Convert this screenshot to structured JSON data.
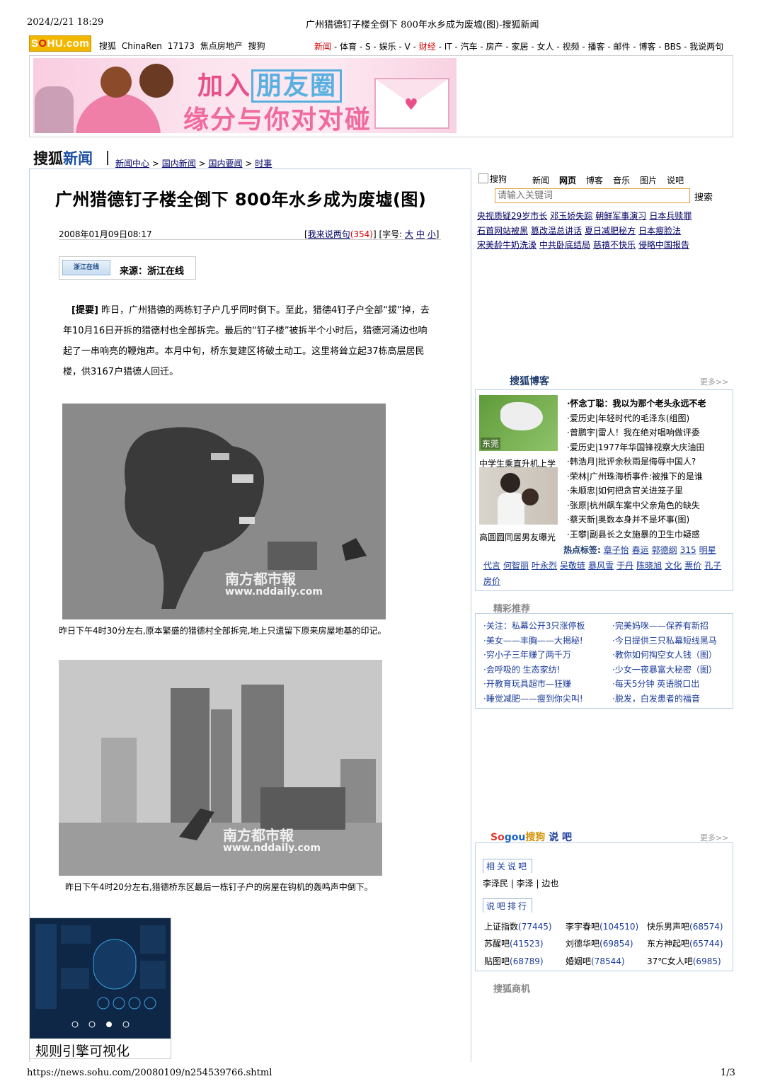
{
  "print": {
    "date": "2024/2/21 18:29",
    "title": "广州猎德钉子楼全倒下 800年水乡成为废墟(图)-搜狐新闻",
    "url": "https://news.sohu.com/20080109/n254539766.shtml",
    "page": "1/3"
  },
  "topbar": {
    "logo_a": "S",
    "logo_b": "O",
    "logo_c": "HU.com",
    "network_links": [
      "搜狐",
      "ChinaRen",
      "17173",
      "焦点房地产",
      "搜狗"
    ],
    "channels": [
      {
        "label": "新闻",
        "highlight": true
      },
      {
        "label": "体育",
        "highlight": false
      },
      {
        "label": "S",
        "highlight": false
      },
      {
        "label": "娱乐",
        "highlight": false
      },
      {
        "label": "V",
        "highlight": false
      },
      {
        "label": "财经",
        "highlight": true
      },
      {
        "label": "IT",
        "highlight": false
      },
      {
        "label": "汽车",
        "highlight": false
      },
      {
        "label": "房产",
        "highlight": false
      },
      {
        "label": "家居",
        "highlight": false
      },
      {
        "label": "女人",
        "highlight": false
      },
      {
        "label": "视频",
        "highlight": false
      },
      {
        "label": "播客",
        "highlight": false
      },
      {
        "label": "邮件",
        "highlight": false
      },
      {
        "label": "博客",
        "highlight": false
      },
      {
        "label": "BBS",
        "highlight": false
      },
      {
        "label": "我说两句",
        "highlight": false
      }
    ]
  },
  "banner": {
    "line1_a": "加入",
    "line1_b": "朋友圈",
    "line2": "缘分与你对对碰",
    "love": "love"
  },
  "section": {
    "logo_a": "搜狐",
    "logo_b": "新闻",
    "breadcrumb": [
      "新闻中心",
      "国内新闻",
      "国内要闻",
      "时事"
    ],
    "sep": ">"
  },
  "article": {
    "title": "广州猎德钉子楼全倒下 800年水乡成为废墟(图)",
    "date": "2008年01月09日08:17",
    "comment_label": "我来说两句",
    "comment_count": "(354)",
    "font_label": "[字号:",
    "font_sizes": [
      "大",
      "中",
      "小"
    ],
    "source_logo": "浙江在线",
    "source": "来源：浙江在线",
    "summary_lead": "[提要]",
    "summary": "昨日，广州猎德的两栋钉子户几乎同时倒下。至此，猎德4钉子户全部“拔”掉，去年10月16日开拆的猎德村也全部拆完。最后的“钉子楼”被拆半个小时后，猎德河涌边也响起了一串响亮的鞭炮声。本月中旬，桥东复建区将破土动工。这里将耸立起37栋高层居民楼，供3167户猎德人回迁。",
    "watermark_a": "南方都市報",
    "watermark_b": "www.nddaily.com",
    "caption1": "昨日下午4时30分左右,原本繁盛的猎德村全部拆完,地上只遗留下原来房屋地基的印记。",
    "caption2": "昨日下午4时20分左右,猎德桥东区最后一栋钉子户的房屋在钩机的轰鸣声中倒下。"
  },
  "ad": {
    "label": "规则引擎可视化"
  },
  "search": {
    "img_alt": "搜狗",
    "tabs": [
      "新闻",
      "网页",
      "博客",
      "音乐",
      "图片",
      "说吧"
    ],
    "active_tab": "网页",
    "placeholder": "请输入关键词",
    "button": "搜索",
    "hot_lines": [
      [
        "央视质疑29岁市长",
        "邓玉娇失踪",
        "朝鲜军事演习",
        "日本兵赎罪"
      ],
      [
        "石首网站被黑",
        "篡改温总讲话",
        "夏日减肥秘方",
        "日本瘦脸法"
      ],
      [
        "宋美龄牛奶洗澡",
        "中共卧底结局",
        "慈禧不快乐",
        "侵略中国报告"
      ]
    ]
  },
  "blog": {
    "title": "搜狐博客",
    "more": "更多>>",
    "thumb1_tag": "东莞",
    "thumb1_caption": "中学生乘直升机上学",
    "thumb2_caption": "高圆圆同居男友曝光",
    "items": [
      "·怀念丁聪：我以为那个老头永远不老",
      "·爱历史|年轻时代的毛泽东(组图)",
      "·曾鹏宇|雷人！我在绝对唱响做评委",
      "·爱历史|1977年华国锋视察大庆油田",
      "·韩浩月|批评余秋雨是侮辱中国人?",
      "·荣林|广州珠海桥事件:被推下的是谁",
      "·朱顺忠|如何把贪官关进笼子里",
      "·张原|杭州飙车案中父亲角色的缺失",
      "·蔡天新|奥数本身并不是坏事(图)",
      "·王攀|副县长之女施暴的卫生巾疑惑"
    ],
    "hot_label": "热点标签:",
    "hot_tags": [
      "章子怡",
      "春运",
      "郭德纲",
      "315",
      "明星",
      "代言",
      "何智丽",
      "叶永烈",
      "吴敬琏",
      "暴风雪",
      "于丹",
      "陈晓旭",
      "文化",
      "票价",
      "孔子",
      "房价"
    ]
  },
  "recommend": {
    "title": "精彩推荐",
    "left": [
      "·关注：私幕公开3只涨停板",
      "·美女——丰胸——大揭秘!",
      "·穷小子三年赚了两千万",
      "·会呼吸的 生态家纺!",
      "·开教育玩具超市—狂赚",
      "·睡觉减肥——瘦到你尖叫!"
    ],
    "right": [
      "·完美妈咪——保养有新招",
      "·今日提供三只私幕短线黑马",
      "·教你如何掏空女人钱（图）",
      "·少女一夜暴富大秘密（图）",
      "·每天5分钟 英语脱口出",
      "·脱发，白发患者的福音"
    ]
  },
  "shuoba": {
    "logo": [
      "So",
      "gou",
      "搜狗",
      "说 吧"
    ],
    "more": "更多>>",
    "tab_related": "相关说吧",
    "related": "李泽民 | 李泽 | 边也",
    "tab_rank": "说吧排行",
    "rank": [
      [
        {
          "name": "上证指数",
          "num": "(77445)"
        },
        {
          "name": "李宇春吧",
          "num": "(104510)"
        },
        {
          "name": "快乐男声吧",
          "num": "(68574)"
        }
      ],
      [
        {
          "name": "苏醒吧",
          "num": "(41523)"
        },
        {
          "name": "刘德华吧",
          "num": "(69854)"
        },
        {
          "name": "东方神起吧",
          "num": "(65744)"
        }
      ],
      [
        {
          "name": "贴图吧",
          "num": "(68789)"
        },
        {
          "name": "婚姻吧",
          "num": "(78544)"
        },
        {
          "name": "37℃女人吧",
          "num": "(6985)"
        }
      ]
    ]
  },
  "business": {
    "title": "搜狐商机"
  }
}
